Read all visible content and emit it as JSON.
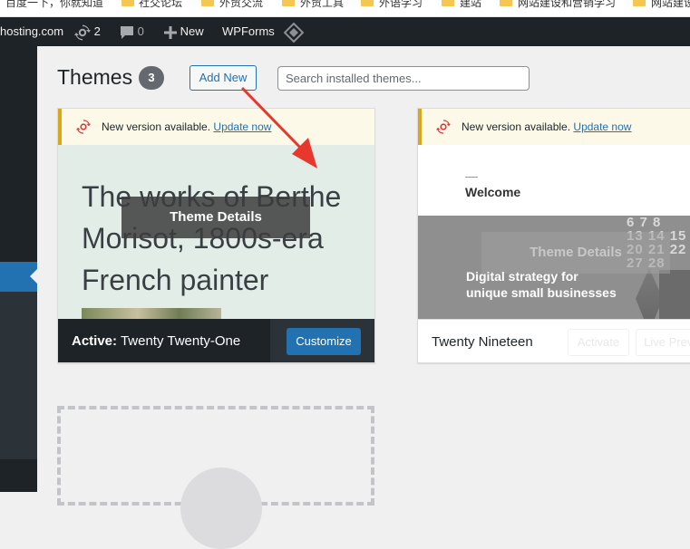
{
  "bookmarks": [
    {
      "label": "百度一下，你就知道",
      "has_folder": false
    },
    {
      "label": "社交论坛",
      "has_folder": true
    },
    {
      "label": "外贸交流",
      "has_folder": true
    },
    {
      "label": "外贸工具",
      "has_folder": true
    },
    {
      "label": "外语学习",
      "has_folder": true
    },
    {
      "label": "建站",
      "has_folder": true
    },
    {
      "label": "网站建设和营销学习",
      "has_folder": true
    },
    {
      "label": "网站建设",
      "has_folder": true
    }
  ],
  "adminbar": {
    "site": "hosting.com",
    "updates_count": "2",
    "comments_count": "0",
    "new_label": "New",
    "wpforms_label": "WPForms"
  },
  "page": {
    "title": "Themes",
    "count": "3",
    "add_new": "Add New",
    "search_placeholder": "Search installed themes..."
  },
  "themes": [
    {
      "notice": "New version available.",
      "notice_link": "Update now",
      "screenshot_text": "The works of Berthe Morisot, 1800s-era French painter",
      "overlay": "Theme Details",
      "active_prefix": "Active:",
      "name": "Twenty Twenty-One",
      "action": "Customize"
    },
    {
      "notice": "New version available.",
      "notice_link": "Update now",
      "welcome": "Welcome",
      "overlay": "Theme Details",
      "tagline_line1": "Digital strategy for",
      "tagline_line2": "unique small businesses",
      "calendar_rows": [
        "6 7 8",
        "13 14 15",
        "20 21 22",
        "27 28"
      ],
      "name": "Twenty Nineteen",
      "action_activate": "Activate",
      "action_preview": "Live Preview"
    }
  ],
  "colors": {
    "admin_bg": "#1d2327",
    "accent": "#2271b1",
    "notice_border": "#dba617",
    "arrow": "#e8372c"
  }
}
